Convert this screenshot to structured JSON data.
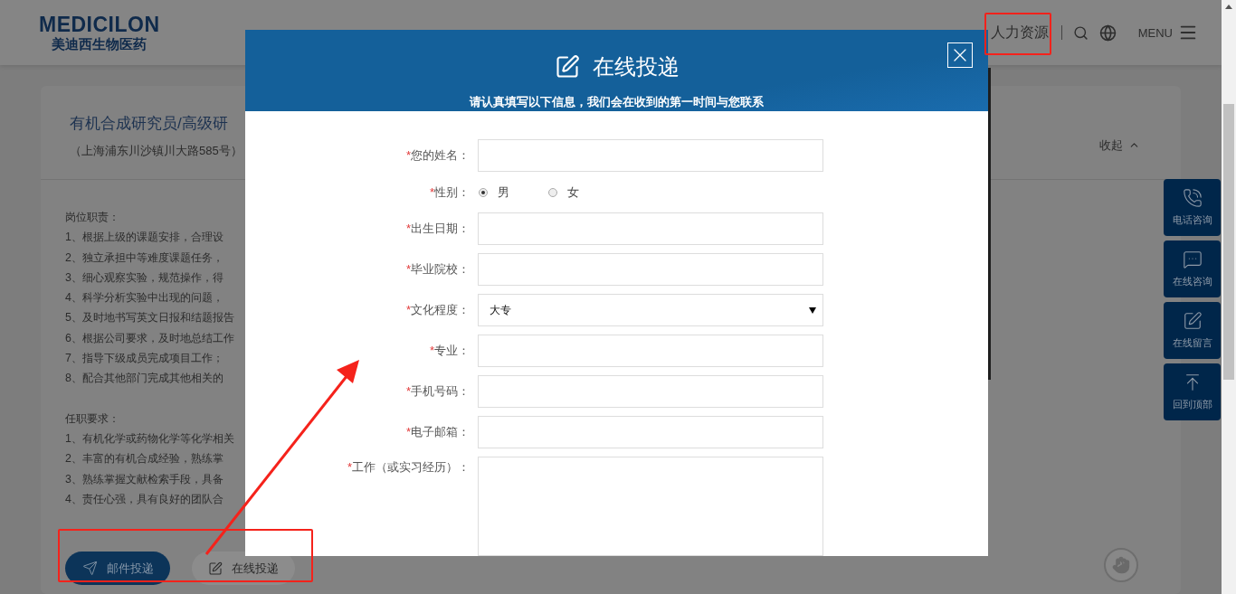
{
  "header": {
    "logo": {
      "name": "MEDICILON",
      "subtitle": "美迪西生物医药"
    },
    "nav_item": "人力资源",
    "menu_label": "MENU"
  },
  "job": {
    "title": "有机合成研究员/高级研",
    "location": "（上海浦东川沙镇川大路585号）",
    "collapse_label": "收起",
    "sections": [
      {
        "heading": "岗位职责：",
        "items": [
          "1、根据上级的课题安排，合理设",
          "2、独立承担中等难度课题任务，",
          "3、细心观察实验，规范操作，得",
          "4、科学分析实验中出现的问题，",
          "5、及时地书写英文日报和结题报告",
          "6、根据公司要求，及时地总结工作",
          "7、指导下级成员完成项目工作；",
          "8、配合其他部门完成其他相关的"
        ]
      },
      {
        "heading": "任职要求：",
        "items": [
          "1、有机化学或药物化学等化学相关",
          "2、丰富的有机合成经验，熟练掌",
          "3、熟练掌握文献检索手段，具备",
          "4、责任心强，具有良好的团队合"
        ]
      }
    ],
    "buttons": [
      {
        "label": "邮件投递",
        "kind": "primary"
      },
      {
        "label": "在线投递",
        "kind": "secondary"
      }
    ]
  },
  "side_tools": [
    {
      "label": "电话咨询",
      "kind": "phone"
    },
    {
      "label": "在线咨询",
      "kind": "chat"
    },
    {
      "label": "在线留言",
      "kind": "note"
    },
    {
      "label": "回到顶部",
      "kind": "top"
    }
  ],
  "modal": {
    "title": "在线投递",
    "subtitle": "请认真填写以下信息，我们会在收到的第一时间与您联系",
    "fields": [
      {
        "label": "您的姓名：",
        "required_mark": "*",
        "kind": "text"
      },
      {
        "label": "性别：",
        "required_mark": "*",
        "kind": "radio",
        "options": [
          {
            "label": "男",
            "selected": true
          },
          {
            "label": "女",
            "selected": false
          }
        ]
      },
      {
        "label": "出生日期：",
        "required_mark": "*",
        "kind": "text"
      },
      {
        "label": "毕业院校：",
        "required_mark": "*",
        "kind": "text"
      },
      {
        "label": "文化程度：",
        "required_mark": "*",
        "kind": "select",
        "value": "大专"
      },
      {
        "label": "专业：",
        "required_mark": "*",
        "kind": "text"
      },
      {
        "label": "手机号码：",
        "required_mark": "*",
        "kind": "text"
      },
      {
        "label": "电子邮箱：",
        "required_mark": "*",
        "kind": "text"
      },
      {
        "label": "工作（或实习经历）：",
        "required_mark": "*",
        "kind": "textarea"
      }
    ]
  }
}
